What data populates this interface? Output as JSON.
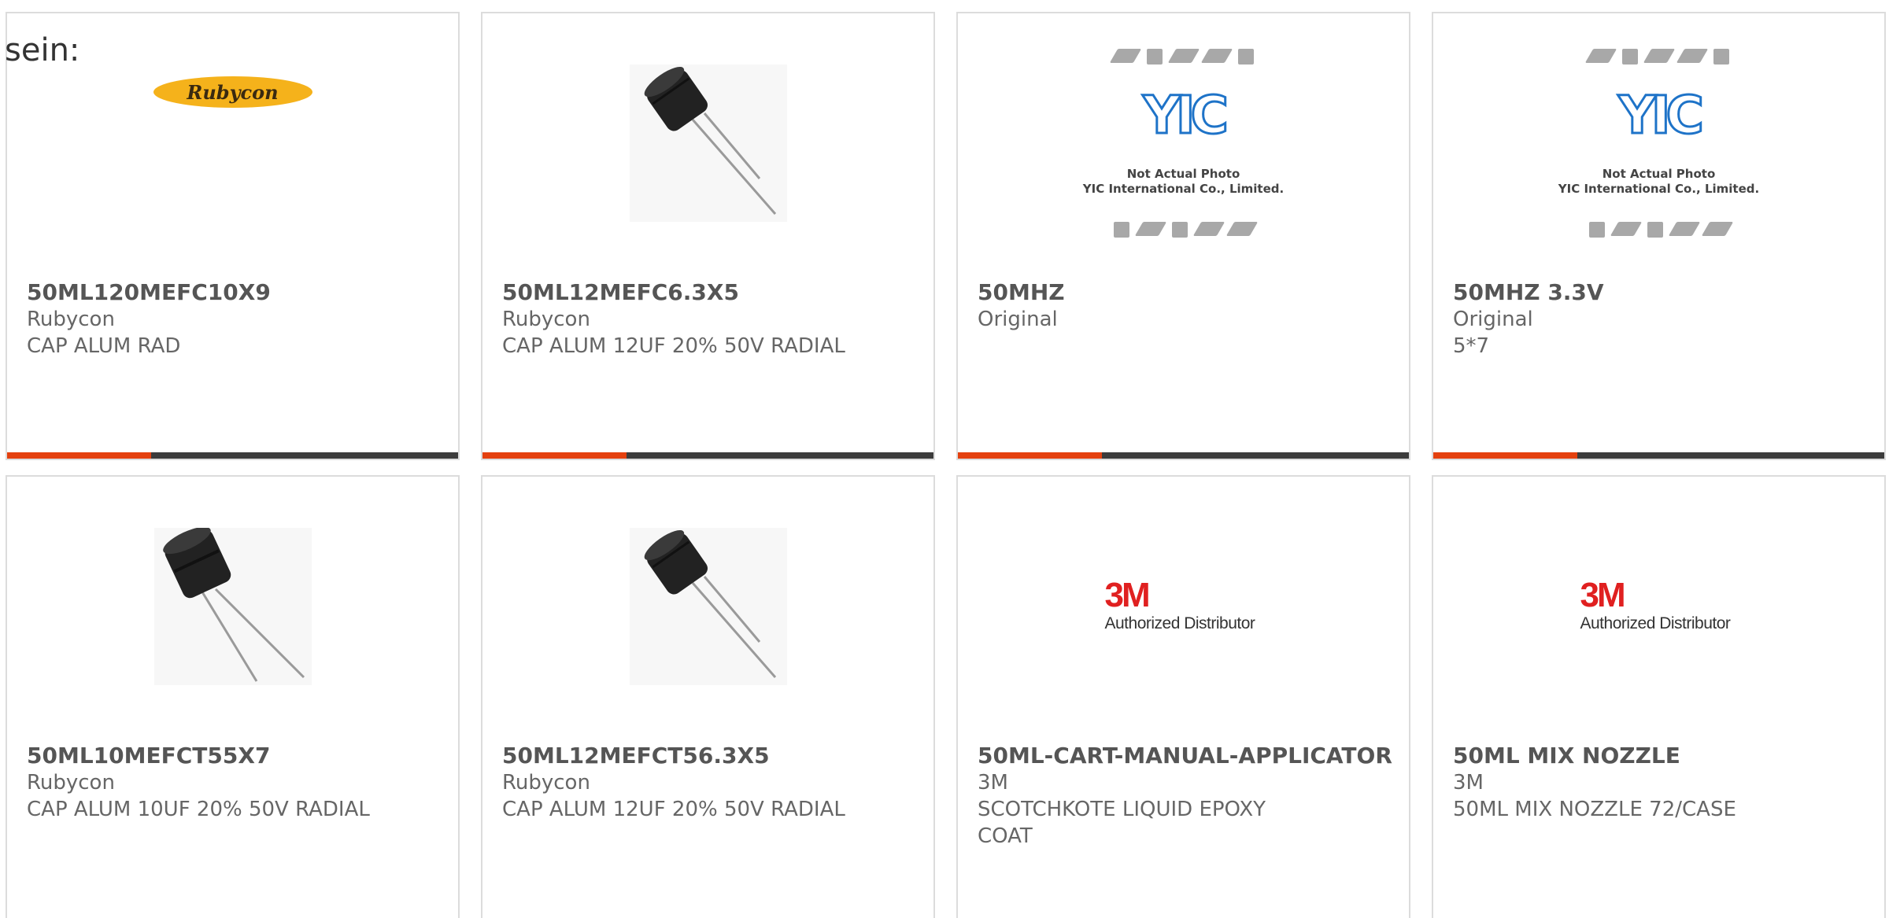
{
  "stray_text": "sein:",
  "colors": {
    "accent": "#e4410f",
    "bar": "#3c3c3c",
    "border": "#dcdcdc",
    "rubycon_yellow": "#f5b21b",
    "yic_blue": "#1e73c8",
    "mmm_red": "#e02020"
  },
  "products": [
    {
      "part_no": "50ML120MEFC10X9",
      "manufacturer": "Rubycon",
      "description": "CAP ALUM RAD",
      "image": "rubycon-logo",
      "logo_text": "Rubycon"
    },
    {
      "part_no": "50ML12MEFC6.3X5",
      "manufacturer": "Rubycon",
      "description": "CAP ALUM 12UF 20% 50V RADIAL",
      "image": "capacitor-photo"
    },
    {
      "part_no": "50MHZ",
      "manufacturer": "Original",
      "description": "",
      "image": "yic-placeholder",
      "logo_text": "YIC",
      "caption_line1": "Not Actual Photo",
      "caption_line2": "YIC International Co., Limited."
    },
    {
      "part_no": "50MHZ 3.3V",
      "manufacturer": "Original",
      "description": "5*7",
      "image": "yic-placeholder",
      "logo_text": "YIC",
      "caption_line1": "Not Actual Photo",
      "caption_line2": "YIC International Co., Limited."
    },
    {
      "part_no": "50ML10MEFCT55X7",
      "manufacturer": "Rubycon",
      "description": "CAP ALUM 10UF 20% 50V RADIAL",
      "image": "capacitor-photo"
    },
    {
      "part_no": "50ML12MEFCT56.3X5",
      "manufacturer": "Rubycon",
      "description": "CAP ALUM 12UF 20% 50V RADIAL",
      "image": "capacitor-photo"
    },
    {
      "part_no": "50ML-CART-MANUAL-APPLICATOR",
      "manufacturer": "3M",
      "description": "SCOTCHKOTE LIQUID EPOXY COAT",
      "image": "3m-logo",
      "logo_text": "3M",
      "logo_sub": "Authorized Distributor"
    },
    {
      "part_no": "50ML MIX NOZZLE",
      "manufacturer": "3M",
      "description": "50ML MIX NOZZLE 72/CASE",
      "image": "3m-logo",
      "logo_text": "3M",
      "logo_sub": "Authorized Distributor"
    }
  ]
}
